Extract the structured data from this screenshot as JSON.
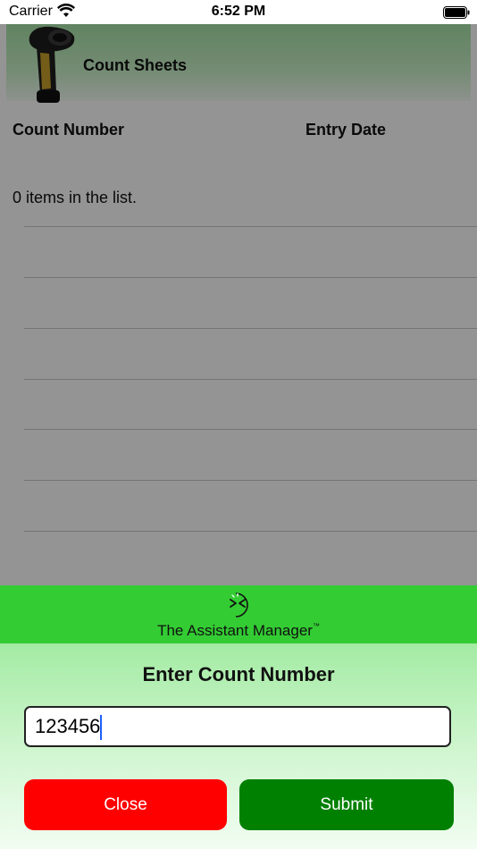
{
  "status_bar": {
    "carrier": "Carrier",
    "time": "6:52 PM"
  },
  "app": {
    "title": "Count Sheets",
    "columns": [
      "Count Number",
      "Entry Date"
    ],
    "items_count_text": "0 items in the list."
  },
  "modal": {
    "brand_name": "The Assistant Manager",
    "brand_tm": "™",
    "title": "Enter Count Number",
    "input_value": "123456",
    "close_label": "Close",
    "submit_label": "Submit"
  },
  "colors": {
    "banner": "#33cc33",
    "close_button": "#ff0000",
    "submit_button": "#008000",
    "header_gradient": "#a8e3a8"
  },
  "icons": [
    "wifi-icon",
    "battery-icon",
    "barcode-scanner-icon",
    "brand-logo-icon"
  ]
}
